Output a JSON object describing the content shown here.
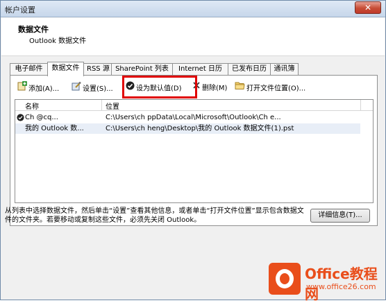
{
  "window": {
    "title": "帐户设置",
    "close_glyph": "✕"
  },
  "header": {
    "title": "数据文件",
    "subtitle": "Outlook 数据文件"
  },
  "tabs": [
    {
      "label": "电子邮件"
    },
    {
      "label": "数据文件"
    },
    {
      "label": "RSS 源"
    },
    {
      "label": "SharePoint 列表"
    },
    {
      "label": "Internet 日历"
    },
    {
      "label": "已发布日历"
    },
    {
      "label": "通讯簿"
    }
  ],
  "toolbar": {
    "add": "添加(A)...",
    "settings": "设置(S)...",
    "set_default": "设为默认值(D)",
    "remove": "删除(M)",
    "open_location": "打开文件位置(O)..."
  },
  "list": {
    "headers": {
      "name": "名称",
      "location": "位置"
    },
    "rows": [
      {
        "name": "Ch          @cq...",
        "location": "C:\\Users\\ch           ppData\\Local\\Microsoft\\Outlook\\Ch           e..."
      },
      {
        "name": "我的 Outlook 数...",
        "location": "C:\\Users\\ch           heng\\Desktop\\我的 Outlook 数据文件(1).pst"
      }
    ]
  },
  "footer": {
    "description": "从列表中选择数据文件，然后单击“设置”查看其他信息，或者单击“打开文件位置”显示包含数据文件的文件夹。若要移动或复制这些文件，必须先关闭 Outlook。",
    "details_button": "详细信息(T)..."
  },
  "watermark": {
    "brand": "Office教程网",
    "url": "www.office26.com"
  },
  "colors": {
    "highlight": "#e00000",
    "brand": "#e94e1b"
  }
}
